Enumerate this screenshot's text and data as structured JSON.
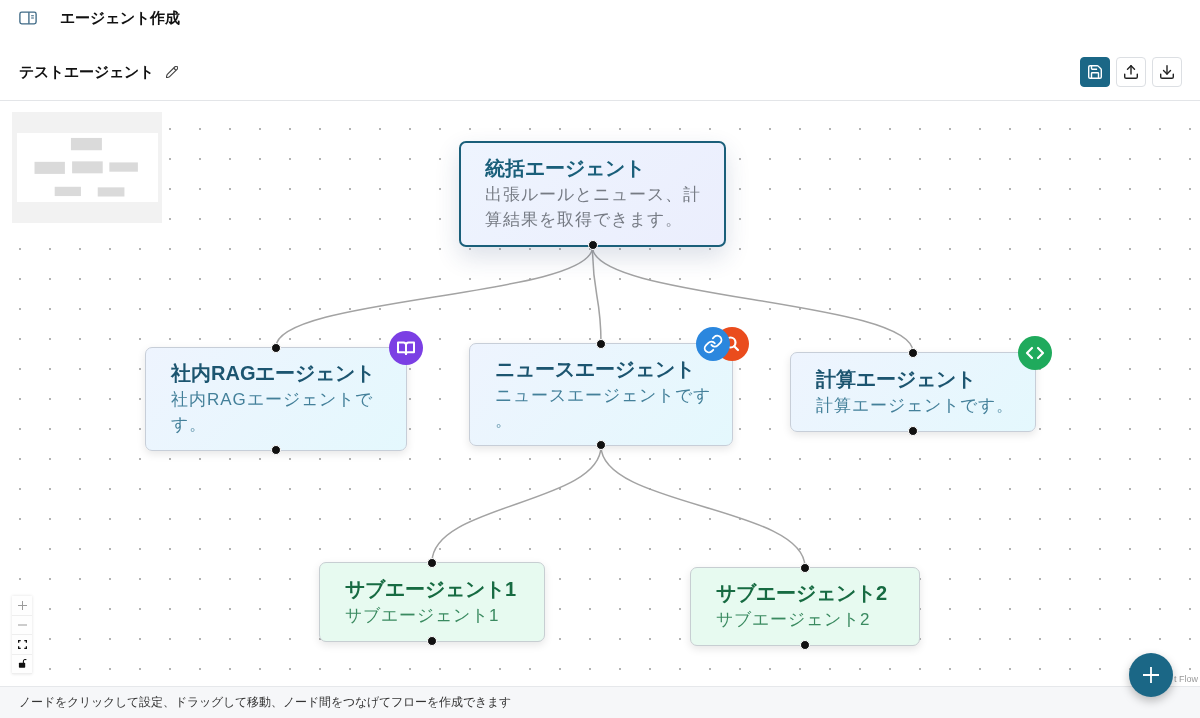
{
  "header": {
    "title": "エージェント作成"
  },
  "toolbar": {
    "agent_name": "テストエージェント"
  },
  "flow": {
    "root": {
      "title": "統括エージェント",
      "description": "出張ルールとニュース、計算結果を取得できます。",
      "children": [
        {
          "title": "社内RAGエージェント",
          "description": "社内RAGエージェントです。",
          "tools": [
            {
              "kind": "rag"
            }
          ]
        },
        {
          "title": "ニュースエージェント",
          "description": "ニュースエージェントです。",
          "tools": [
            {
              "kind": "url"
            },
            {
              "kind": "search"
            }
          ],
          "children": [
            {
              "title": "サブエージェント1",
              "description": "サブエージェント1"
            },
            {
              "title": "サブエージェント2",
              "description": "サブエージェント2"
            }
          ]
        },
        {
          "title": "計算エージェント",
          "description": "計算エージェントです。",
          "tools": [
            {
              "kind": "code"
            }
          ]
        }
      ]
    },
    "attribution": "t Flow"
  },
  "status_bar": "ノードをクリックして設定、ドラッグして移動、ノード間をつなげてフローを作成できます"
}
